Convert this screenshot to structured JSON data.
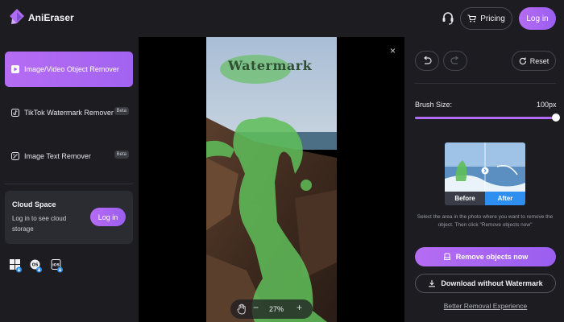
{
  "header": {
    "app_title": "AniEraser",
    "pricing_label": "Pricing",
    "login_label": "Log in"
  },
  "sidebar": {
    "items": [
      {
        "label": "Image/Video Object Remover",
        "active": true
      },
      {
        "label": "TikTok Watermark Remover",
        "badge": "Beta"
      },
      {
        "label": "Image Text Remover",
        "badge": "Beta"
      }
    ],
    "cloud": {
      "title": "Cloud Space",
      "description": "Log in to see cloud storage",
      "login_label": "Log in"
    },
    "platforms": [
      "windows-icon",
      "macos-icon",
      "ios-icon"
    ]
  },
  "canvas": {
    "watermark_text": "Watermark",
    "zoom_value": "27%",
    "zoom_minus": "−",
    "zoom_plus": "+",
    "close_glyph": "×"
  },
  "panel": {
    "reset_label": "Reset",
    "brush_label": "Brush Size:",
    "brush_value": "100px",
    "brush_fraction": 1.0,
    "preview_before": "Before",
    "preview_after": "After",
    "hint": "Select the area in the photo where you want to remove the object. Then click \"Remove objects now\"",
    "remove_label": "Remove objects now",
    "download_label": "Download without Watermark",
    "better_link": "Better Removal Experience"
  },
  "colors": {
    "accent": "#b06bf3",
    "mask_green": "#5fbf5a",
    "after_blue": "#2f8ff0"
  }
}
